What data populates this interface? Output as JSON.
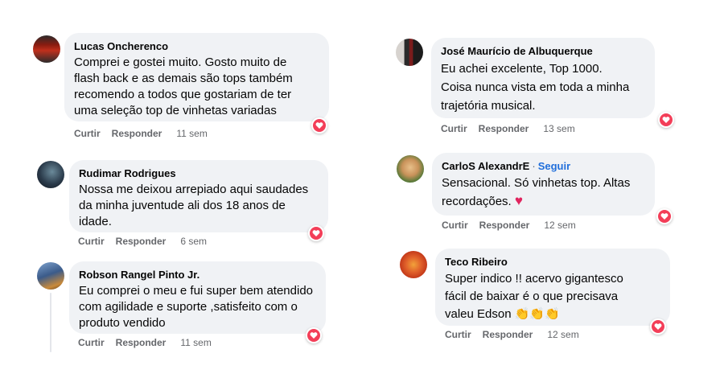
{
  "comments": [
    {
      "id": "c1",
      "author": "Lucas Oncherenco",
      "lines": [
        "Comprei e gostei muito. Gosto muito de",
        "flash back e as demais são tops também",
        "recomendo a todos que gostariam de ter",
        "uma seleção top de vinhetas variadas"
      ],
      "like_label": "Curtir",
      "reply_label": "Responder",
      "time": "11 sem",
      "avatar_colors": [
        "#8a1c10",
        "#2b2b2b"
      ]
    },
    {
      "id": "c2",
      "author": "Rudimar Rodrigues",
      "lines": [
        "Nossa me deixou arrepiado aqui saudades",
        "da minha juventude ali dos 18 anos de",
        "idade."
      ],
      "like_label": "Curtir",
      "reply_label": "Responder",
      "time": "6 sem",
      "avatar_colors": [
        "#1d2a3a",
        "#4b6a7a"
      ]
    },
    {
      "id": "c3",
      "author": "Robson Rangel Pinto Jr.",
      "lines": [
        "Eu comprei o meu e fui super bem atendido",
        "com agilidade e suporte ,satisfeito com o",
        "produto vendido"
      ],
      "like_label": "Curtir",
      "reply_label": "Responder",
      "time": "11 sem",
      "avatar_colors": [
        "#3b5b8a",
        "#c98a3a"
      ]
    },
    {
      "id": "c4",
      "author": "José Maurício de Albuquerque",
      "lines": [
        "Eu achei excelente, Top 1000.",
        "Coisa nunca vista em toda a minha",
        "trajetória musical."
      ],
      "like_label": "Curtir",
      "reply_label": "Responder",
      "time": "13 sem",
      "avatar_colors": [
        "#d7d3cf",
        "#7a1c1c"
      ]
    },
    {
      "id": "c5",
      "author": "CarloS AlexandrE",
      "separator": "·",
      "follow_label": "Seguir",
      "lines": [
        "Sensacional. Só vinhetas top. Altas",
        "recordações."
      ],
      "emoji": "♥",
      "like_label": "Curtir",
      "reply_label": "Responder",
      "time": "12 sem",
      "avatar_colors": [
        "#e8c08a",
        "#3a5a2a"
      ]
    },
    {
      "id": "c6",
      "author": "Teco Ribeiro",
      "lines": [
        "Super indico !! acervo gigantesco",
        "fácil de baixar é o que precisava",
        "valeu Edson"
      ],
      "emoji": "👏👏👏",
      "like_label": "Curtir",
      "reply_label": "Responder",
      "time": "12 sem",
      "avatar_colors": [
        "#c43a1a",
        "#f2a23a"
      ]
    }
  ],
  "colors": {
    "bubble": "#f0f2f5",
    "secondary_text": "#65676b",
    "link_blue": "#216fdb",
    "reaction_red": "#f33e58"
  },
  "icons": {
    "reaction": "heart-icon"
  }
}
